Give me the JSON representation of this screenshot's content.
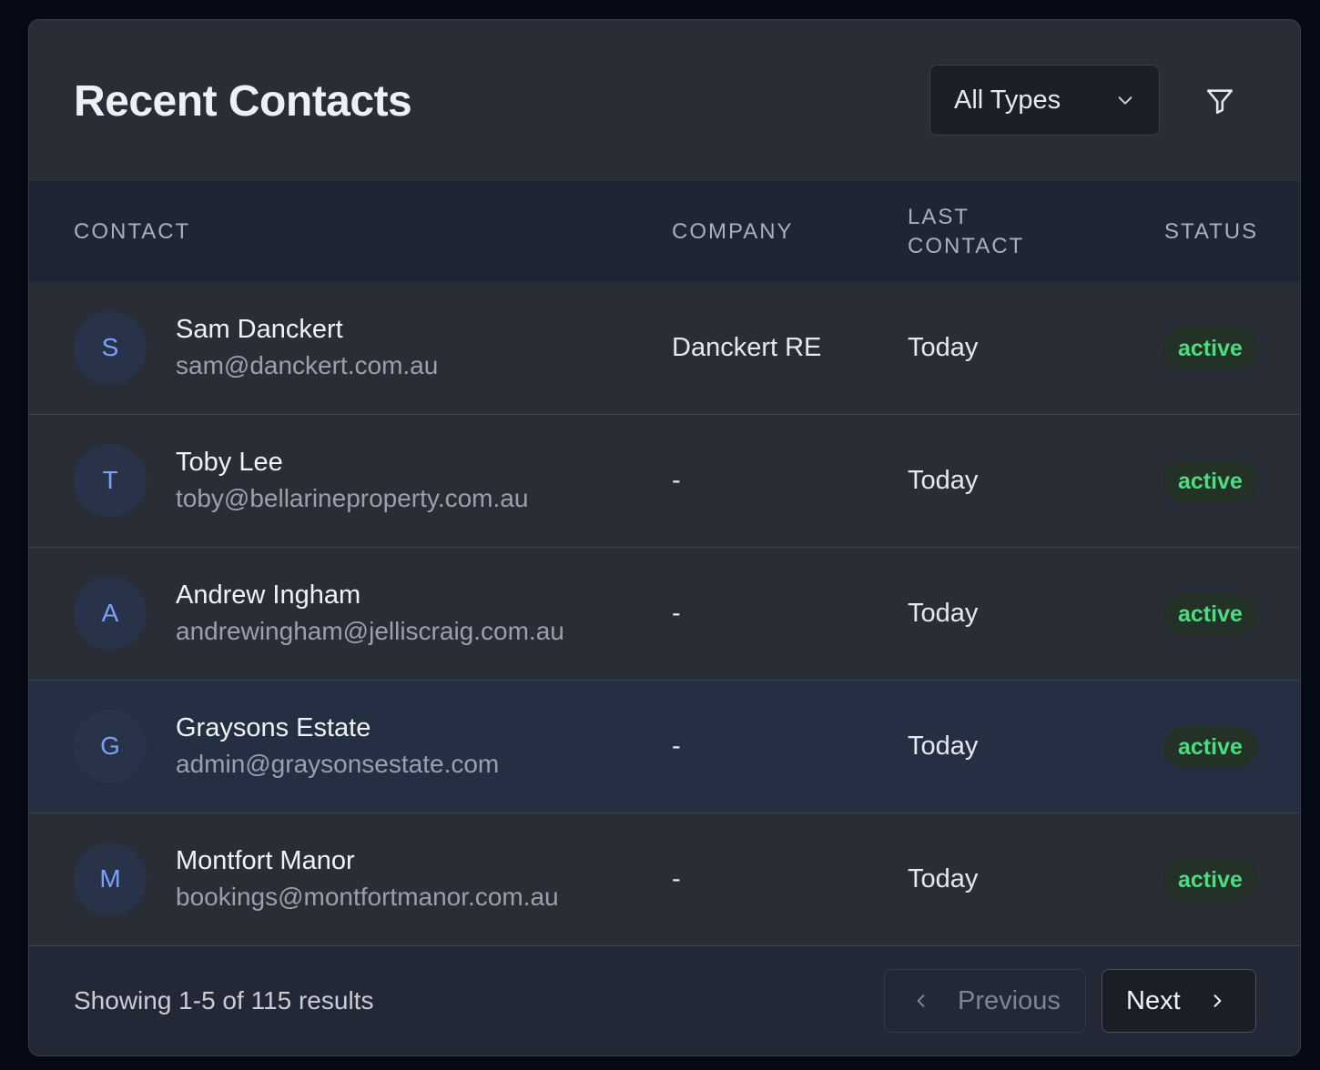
{
  "header": {
    "title": "Recent Contacts",
    "type_filter": "All Types"
  },
  "columns": {
    "contact": "CONTACT",
    "company": "COMPANY",
    "last_contact_line1": "LAST",
    "last_contact_line2": "CONTACT",
    "status": "STATUS"
  },
  "contacts": [
    {
      "initial": "S",
      "name": "Sam Danckert",
      "email": "sam@danckert.com.au",
      "company": "Danckert RE",
      "last_contact": "Today",
      "status": "active"
    },
    {
      "initial": "T",
      "name": "Toby Lee",
      "email": "toby@bellarineproperty.com.au",
      "company": "-",
      "last_contact": "Today",
      "status": "active"
    },
    {
      "initial": "A",
      "name": "Andrew Ingham",
      "email": "andrewingham@jelliscraig.com.au",
      "company": "-",
      "last_contact": "Today",
      "status": "active"
    },
    {
      "initial": "G",
      "name": "Graysons Estate",
      "email": "admin@graysonsestate.com",
      "company": "-",
      "last_contact": "Today",
      "status": "active"
    },
    {
      "initial": "M",
      "name": "Montfort Manor",
      "email": "bookings@montfortmanor.com.au",
      "company": "-",
      "last_contact": "Today",
      "status": "active"
    }
  ],
  "footer": {
    "summary": "Showing 1-5 of 115 results",
    "previous_label": "Previous",
    "next_label": "Next"
  },
  "colors": {
    "status_active": "#4ade80",
    "avatar_text": "#7aa2f7",
    "highlight_row": "#252f44"
  },
  "icons": {
    "select": "chevron-down-icon",
    "filter": "filter-icon",
    "previous": "chevron-left-icon",
    "next": "chevron-right-icon"
  }
}
